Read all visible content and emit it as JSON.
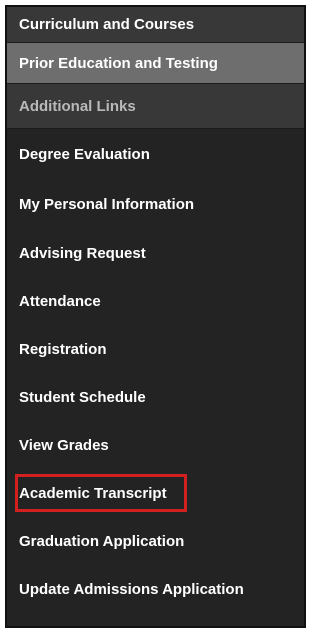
{
  "menu": {
    "headers": [
      {
        "label": "Curriculum and Courses"
      },
      {
        "label": "Prior Education and Testing"
      },
      {
        "label": "Additional Links"
      }
    ],
    "links": [
      {
        "label": "Degree Evaluation"
      },
      {
        "label": "My Personal Information"
      },
      {
        "label": "Advising Request"
      },
      {
        "label": "Attendance"
      },
      {
        "label": "Registration"
      },
      {
        "label": "Student Schedule"
      },
      {
        "label": "View Grades"
      },
      {
        "label": "Academic Transcript"
      },
      {
        "label": "Graduation Application"
      },
      {
        "label": "Update Admissions Application"
      }
    ]
  },
  "highlighted_item": "Student Schedule",
  "colors": {
    "panel_bg": "#232323",
    "active_header_bg": "#6e6e6e",
    "highlight_border": "#d21f1f"
  }
}
